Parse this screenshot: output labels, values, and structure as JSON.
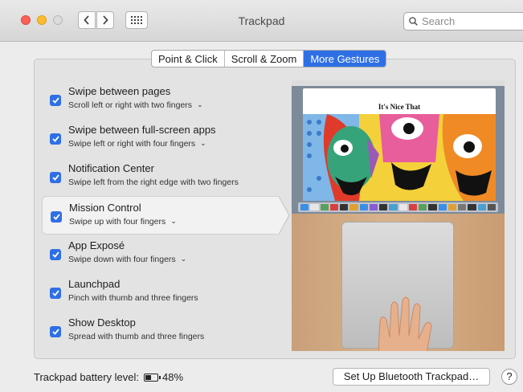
{
  "window": {
    "title": "Trackpad"
  },
  "toolbar": {
    "search_placeholder": "Search"
  },
  "tabs": [
    {
      "label": "Point & Click",
      "active": false
    },
    {
      "label": "Scroll & Zoom",
      "active": false
    },
    {
      "label": "More Gestures",
      "active": true
    }
  ],
  "gestures": [
    {
      "title": "Swipe between pages",
      "subtitle": "Scroll left or right with two fingers",
      "checked": true,
      "has_menu": true,
      "selected": false
    },
    {
      "title": "Swipe between full-screen apps",
      "subtitle": "Swipe left or right with four fingers",
      "checked": true,
      "has_menu": true,
      "selected": false
    },
    {
      "title": "Notification Center",
      "subtitle": "Swipe left from the right edge with two fingers",
      "checked": true,
      "has_menu": false,
      "selected": false
    },
    {
      "title": "Mission Control",
      "subtitle": "Swipe up with four fingers",
      "checked": true,
      "has_menu": true,
      "selected": true
    },
    {
      "title": "App Exposé",
      "subtitle": "Swipe down with four fingers",
      "checked": true,
      "has_menu": true,
      "selected": false
    },
    {
      "title": "Launchpad",
      "subtitle": "Pinch with thumb and three fingers",
      "checked": true,
      "has_menu": false,
      "selected": false
    },
    {
      "title": "Show Desktop",
      "subtitle": "Spread with thumb and three fingers",
      "checked": true,
      "has_menu": false,
      "selected": false
    }
  ],
  "preview": {
    "site_title": "It's Nice That"
  },
  "footer": {
    "battery_label": "Trackpad battery level:",
    "battery_percent": "48%",
    "battery_level": 0.48,
    "setup_button": "Set Up Bluetooth Trackpad…",
    "help_label": "?"
  },
  "colors": {
    "accent": "#2f6fe6",
    "close": "#fc5f57",
    "minimize": "#fdbc2e"
  }
}
